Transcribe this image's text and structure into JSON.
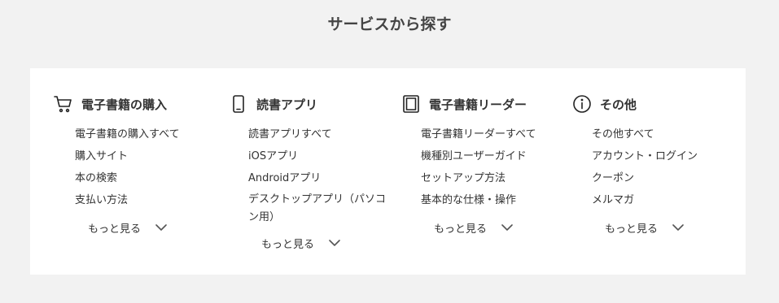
{
  "title": "サービスから探す",
  "columns": [
    {
      "heading": "電子書籍の購入",
      "icon": "shopping-cart-icon",
      "links": [
        "電子書籍の購入すべて",
        "購入サイト",
        "本の検索",
        "支払い方法"
      ],
      "more_label": "もっと見る"
    },
    {
      "heading": "読書アプリ",
      "icon": "smartphone-icon",
      "links": [
        "読書アプリすべて",
        "iOSアプリ",
        "Androidアプリ",
        "デスクトップアプリ（パソコン用）"
      ],
      "more_label": "もっと見る"
    },
    {
      "heading": "電子書籍リーダー",
      "icon": "ereader-icon",
      "links": [
        "電子書籍リーダーすべて",
        "機種別ユーザーガイド",
        "セットアップ方法",
        "基本的な仕様・操作"
      ],
      "more_label": "もっと見る"
    },
    {
      "heading": "その他",
      "icon": "info-icon",
      "links": [
        "その他すべて",
        "アカウント・ログイン",
        "クーポン",
        "メルマガ"
      ],
      "more_label": "もっと見る"
    }
  ],
  "colors": {
    "background": "#f2f2f2",
    "panel": "#ffffff",
    "text": "#333333",
    "icon": "#222222"
  }
}
